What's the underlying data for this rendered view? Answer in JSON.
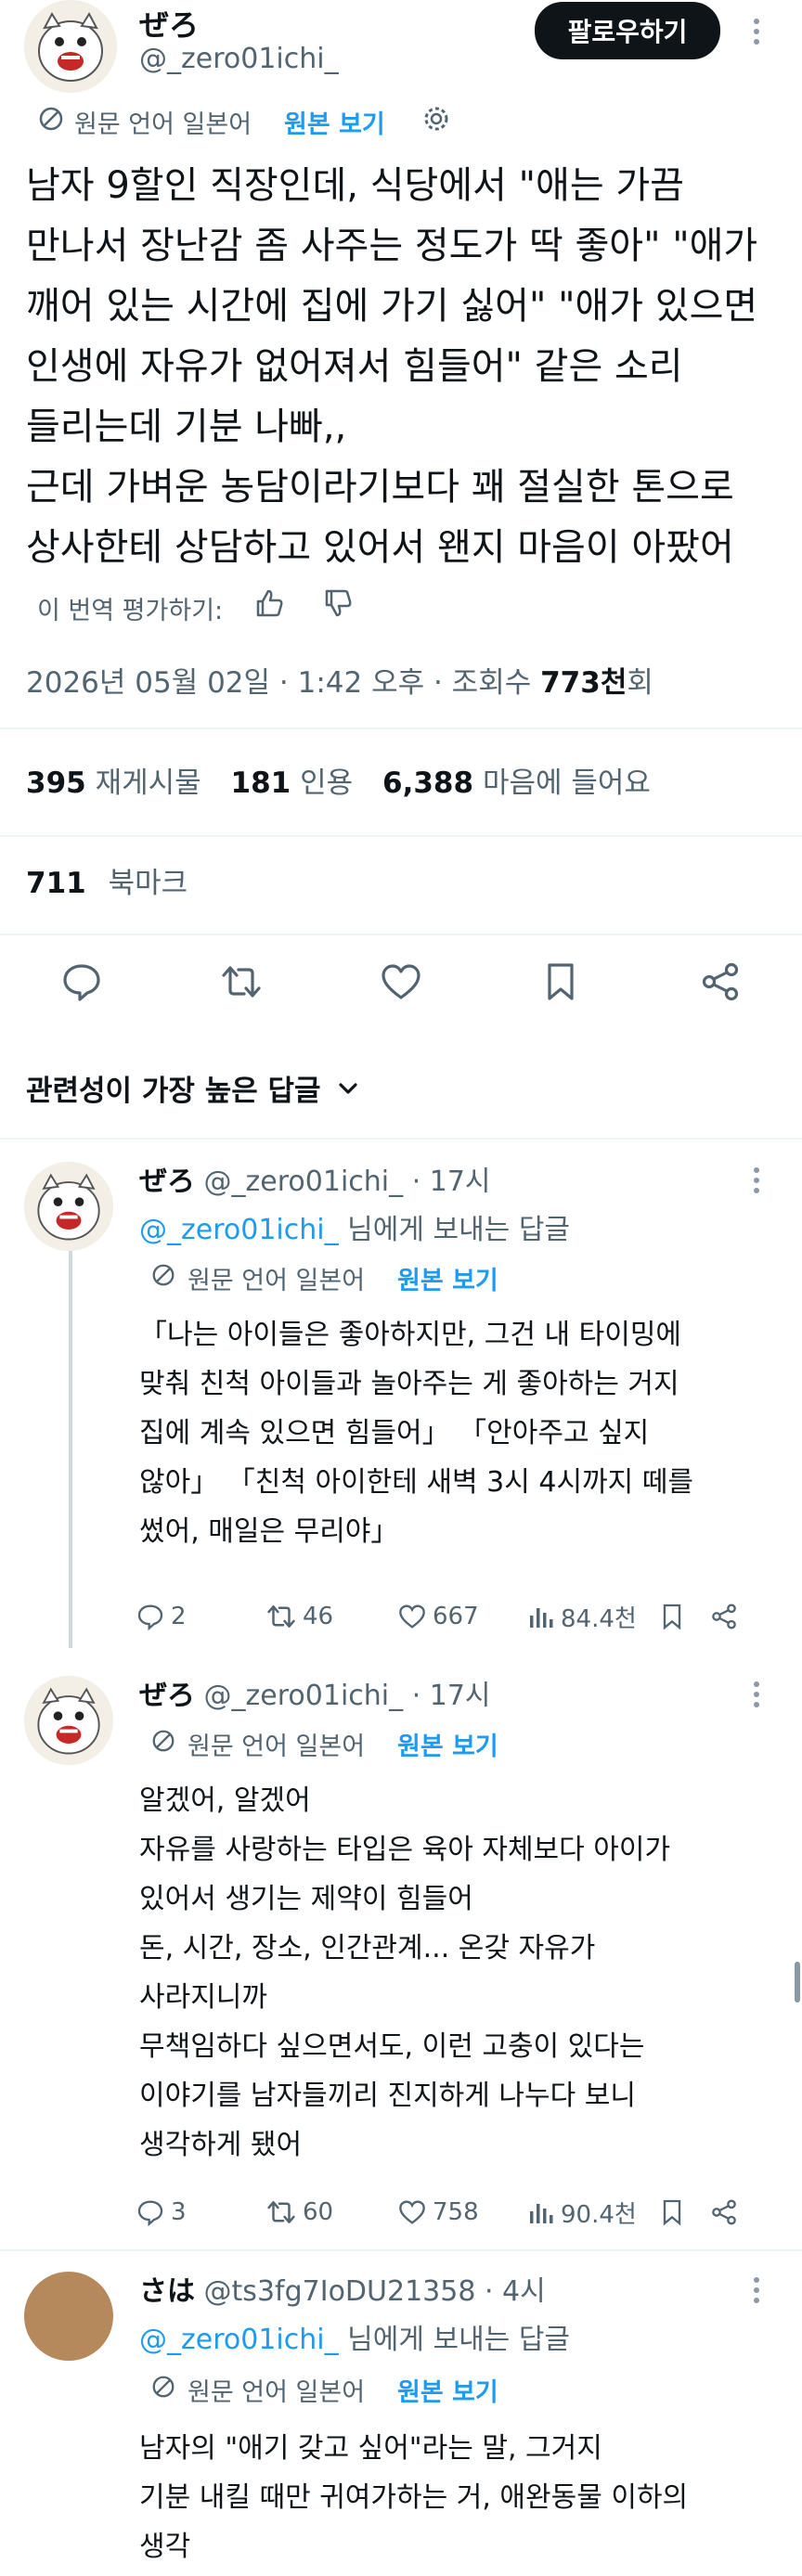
{
  "main_post": {
    "display_name": "ぜろ",
    "handle": "@_zero01ichi_",
    "follow_label": "팔로우하기",
    "translation": {
      "source_label": "원문 언어 일본어",
      "view_original": "원본 보기"
    },
    "text_lines": [
      "남자 9할인 직장인데, 식당에서 \"애는 가끔",
      "만나서 장난감 좀 사주는 정도가 딱 좋아\" \"애가",
      "깨어 있는 시간에 집에 가기 싫어\" \"애가 있으면",
      "인생에 자유가 없어져서 힘들어\" 같은 소리",
      "들리는데 기분 나빠,,",
      "근데 가벼운 농담이라기보다 꽤 절실한 톤으로",
      "상사한테 상담하고 있어서 왠지 마음이 아팠어"
    ],
    "rate_translation": "이 번역 평가하기:",
    "timestamp": "2026년 05월 02일 · 1:42 오후 · 조회수",
    "views_number": "773천",
    "views_suffix": "회",
    "stats": {
      "reposts_count": "395",
      "reposts_label": "재게시물",
      "quotes_count": "181",
      "quotes_label": "인용",
      "likes_count": "6,388",
      "likes_label": "마음에 들어요",
      "bookmarks_count": "711",
      "bookmarks_label": "북마크"
    },
    "sort_label": "관련성이 가장 높은 답글"
  },
  "replies": [
    {
      "display_name": "ぜろ",
      "handle": "@_zero01ichi_",
      "time": "· 17시",
      "reply_to_handle": "@_zero01ichi_",
      "reply_to_suffix": "님에게 보내는 답글",
      "translation_label": "원문 언어 일본어",
      "view_original": "원본 보기",
      "text_lines": [
        "「나는 아이들은 좋아하지만, 그건 내 타이밍에",
        "맞춰 친척 아이들과 놀아주는 게 좋아하는 거지",
        "집에 계속 있으면 힘들어」 「안아주고 싶지",
        "않아」 「친척 아이한테 새벽 3시 4시까지 떼를",
        "썼어, 매일은 무리야」"
      ],
      "replies": "2",
      "reposts": "46",
      "likes": "667",
      "views": "84.4천"
    },
    {
      "display_name": "ぜろ",
      "handle": "@_zero01ichi_",
      "time": "· 17시",
      "translation_label": "원문 언어 일본어",
      "view_original": "원본 보기",
      "text_lines": [
        "알겠어, 알겠어",
        "자유를 사랑하는 타입은 육아 자체보다 아이가",
        "있어서 생기는 제약이 힘들어",
        "돈, 시간, 장소, 인간관계... 온갖 자유가",
        "사라지니까",
        "무책임하다 싶으면서도, 이런 고충이 있다는",
        "이야기를 남자들끼리 진지하게 나누다 보니",
        "생각하게 됐어"
      ],
      "replies": "3",
      "reposts": "60",
      "likes": "758",
      "views": "90.4천"
    },
    {
      "display_name": "さは",
      "handle": "@ts3fg7IoDU21358",
      "time": "· 4시",
      "reply_to_handle": "@_zero01ichi_",
      "reply_to_suffix": "님에게 보내는 답글",
      "translation_label": "원문 언어 일본어",
      "view_original": "원본 보기",
      "text_lines": [
        "남자의 \"애기 갖고 싶어\"라는 말, 그거지",
        "기분 내킬 때만 귀여가하는 거, 애완동물 이하의",
        "생각"
      ]
    }
  ],
  "colors": {
    "accent_blue": "#1d9bf0",
    "muted_gray": "#536471",
    "text_black": "#0f1419",
    "divider": "#eff3f4"
  }
}
